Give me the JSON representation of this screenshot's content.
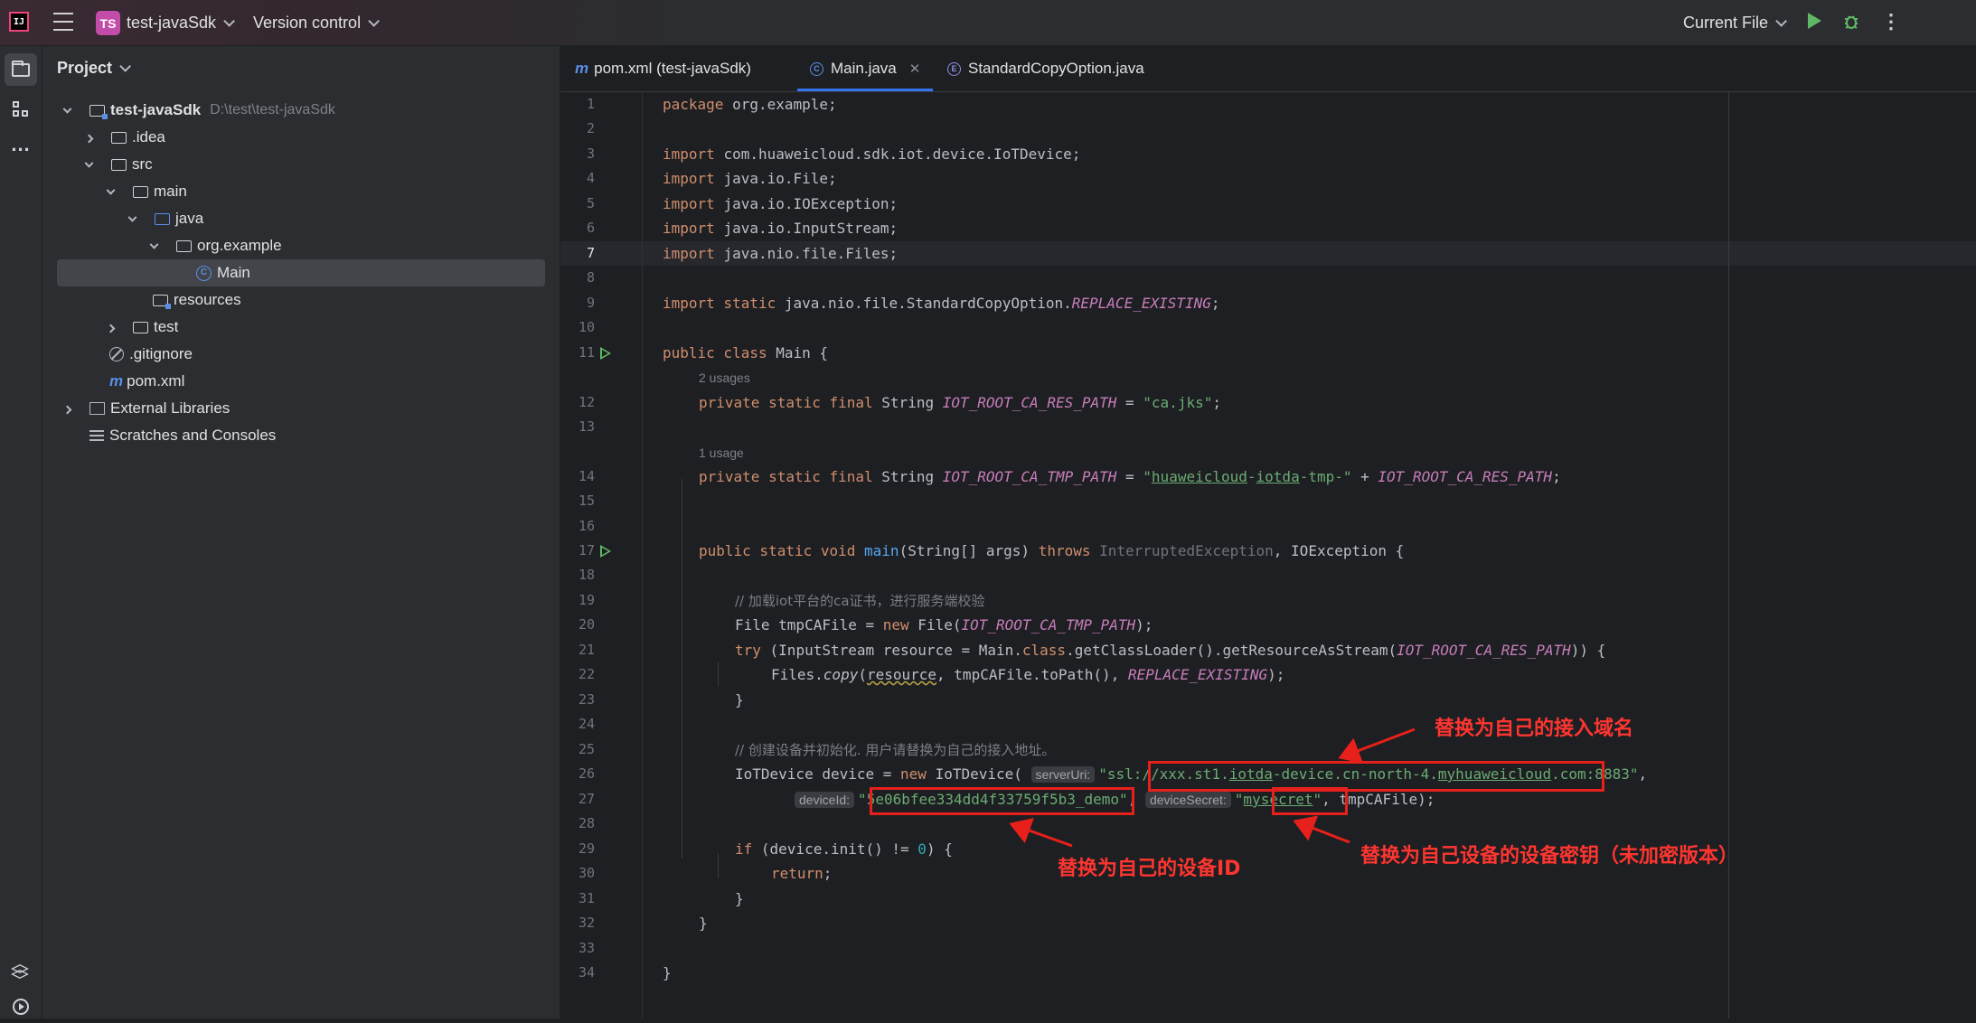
{
  "titlebar": {
    "project_badge": "TS",
    "project_name": "test-javaSdk",
    "version_control": "Version control",
    "run_config": "Current File",
    "icons": [
      "app-logo-icon",
      "main-menu-icon",
      "run-icon",
      "debug-icon",
      "more-actions-icon"
    ]
  },
  "project_panel": {
    "title": "Project",
    "tree": [
      {
        "label": "test-javaSdk",
        "path": "D:\\test\\test-javaSdk",
        "icon": "module-folder-icon"
      },
      {
        "label": ".idea",
        "icon": "folder-icon"
      },
      {
        "label": "src",
        "icon": "folder-icon"
      },
      {
        "label": "main",
        "icon": "folder-icon"
      },
      {
        "label": "java",
        "icon": "source-folder-icon"
      },
      {
        "label": "org.example",
        "icon": "package-icon"
      },
      {
        "label": "Main",
        "icon": "class-icon"
      },
      {
        "label": "resources",
        "icon": "resources-folder-icon"
      },
      {
        "label": "test",
        "icon": "folder-icon"
      },
      {
        "label": ".gitignore",
        "icon": "ignore-file-icon"
      },
      {
        "label": "pom.xml",
        "icon": "maven-icon"
      },
      {
        "label": "External Libraries",
        "icon": "library-icon"
      },
      {
        "label": "Scratches and Consoles",
        "icon": "scratch-icon"
      }
    ]
  },
  "tabs": [
    {
      "label": "pom.xml (test-javaSdk)",
      "icon": "maven-icon",
      "active": false
    },
    {
      "label": "Main.java",
      "icon": "class-icon",
      "active": true
    },
    {
      "label": "StandardCopyOption.java",
      "icon": "enum-icon",
      "active": false
    }
  ],
  "editor": {
    "current_line": 7,
    "line_numbers": [
      "1",
      "2",
      "3",
      "4",
      "5",
      "6",
      "7",
      "8",
      "9",
      "10",
      "11",
      "12",
      "13",
      "14",
      "15",
      "16",
      "17",
      "18",
      "19",
      "20",
      "21",
      "22",
      "23",
      "24",
      "25",
      "26",
      "27",
      "28",
      "29",
      "30",
      "31",
      "32",
      "33",
      "34"
    ],
    "code": {
      "package": "org.example;",
      "import1": "com.huaweicloud.sdk.iot.device.IoTDevice;",
      "import2": "java.io.File;",
      "import3": "java.io.IOException;",
      "import4": "java.io.InputStream;",
      "import5": "java.nio.file.Files;",
      "import6_prefix": "java.nio.file.StandardCopyOption.",
      "import6_const": "REPLACE_EXISTING",
      "usages_2": "2 usages",
      "usages_1": "1 usage",
      "const_res": "IOT_ROOT_CA_RES_PATH",
      "const_tmp": "IOT_ROOT_CA_TMP_PATH",
      "ca_jks": "\"ca.jks\"",
      "tmp_prefix_a": "\"",
      "tmp_prefix_b": "huaweicloud",
      "tmp_prefix_c": "-",
      "tmp_prefix_d": "iotda",
      "tmp_prefix_e": "-tmp-\"",
      "comment1": "// 加载iot平台的ca证书，进行服务端校验",
      "comment2": "// 创建设备并初始化. 用户请替换为自己的接入地址。",
      "server_uri_hint": "serverUri:",
      "device_id_hint": "deviceId:",
      "device_secret_hint": "deviceSecret:",
      "server_uri_a": "\"ssl://xxx.st1.",
      "server_uri_b": "iotda",
      "server_uri_c": "-device.cn-north-4.",
      "server_uri_d": "myhuaweicloud",
      "server_uri_e": ".com:8883\"",
      "device_id": "5e06bfee334dd4f33759f5b3_demo",
      "device_secret": "mysecret"
    }
  },
  "annotations": {
    "domain": "替换为自己的接入域名",
    "device_id": "替换为自己的设备ID",
    "secret": "替换为自己设备的设备密钥（未加密版本）",
    "color": "#ff3530"
  }
}
